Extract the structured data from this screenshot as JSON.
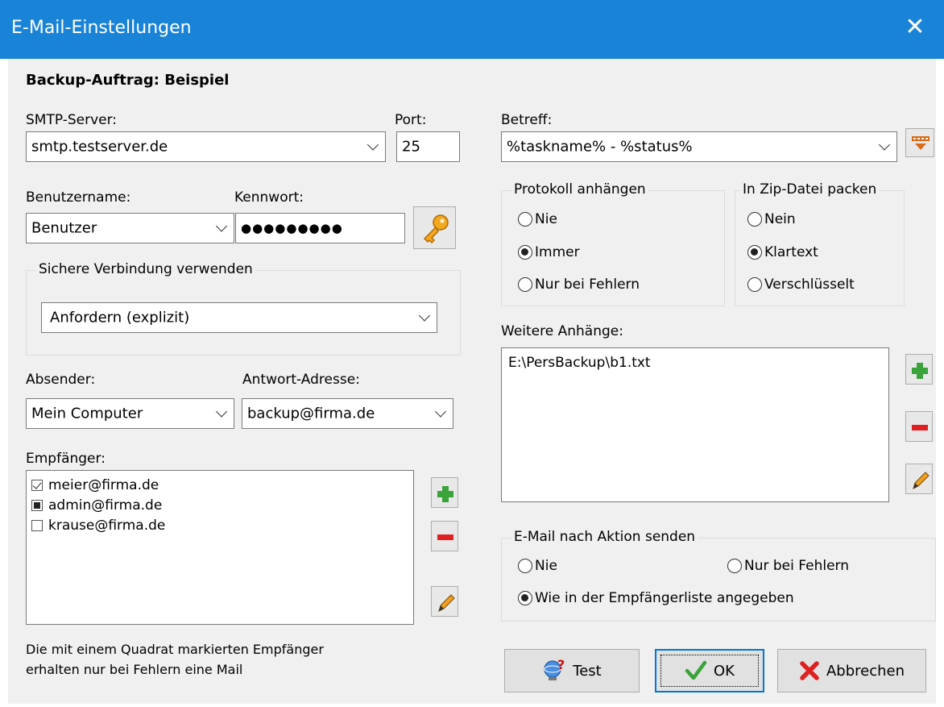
{
  "window": {
    "title": "E-Mail-Einstellungen",
    "close_glyph": "✕"
  },
  "task_label": "Backup-Auftrag: Beispiel",
  "smtp": {
    "label": "SMTP-Server:",
    "value": "smtp.testserver.de"
  },
  "port": {
    "label": "Port:",
    "value": "25"
  },
  "username": {
    "label": "Benutzername:",
    "value": "Benutzer"
  },
  "password": {
    "label": "Kennwort:",
    "value": "●●●●●●●●●"
  },
  "secure": {
    "group_title": "Sichere Verbindung verwenden",
    "value": "Anfordern (explizit)"
  },
  "sender": {
    "label": "Absender:",
    "value": "Mein Computer"
  },
  "reply": {
    "label": "Antwort-Adresse:",
    "value": "backup@firma.de"
  },
  "recipients": {
    "label": "Empfänger:",
    "items": [
      {
        "address": "meier@firma.de",
        "state": "checked"
      },
      {
        "address": "admin@firma.de",
        "state": "square"
      },
      {
        "address": "krause@firma.de",
        "state": "unchecked"
      }
    ]
  },
  "note": {
    "line1": "Die mit einem Quadrat markierten Empfänger",
    "line2": "erhalten nur bei Fehlern eine Mail"
  },
  "subject": {
    "label": "Betreff:",
    "value": "%taskname% - %status%"
  },
  "attach_log": {
    "group_title": "Protokoll anhängen",
    "options": [
      "Nie",
      "Immer",
      "Nur bei Fehlern"
    ],
    "selected": "Immer"
  },
  "zip": {
    "group_title": "In Zip-Datei packen",
    "options": [
      "Nein",
      "Klartext",
      "Verschlüsselt"
    ],
    "selected": "Klartext"
  },
  "attachments": {
    "label": "Weitere Anhänge:",
    "items": [
      "E:\\PersBackup\\b1.txt"
    ]
  },
  "send_mail": {
    "group_title": "E-Mail nach Aktion senden",
    "options": [
      "Nie",
      "Nur bei Fehlern",
      "Wie in der Empfängerliste angegeben"
    ],
    "selected": "Wie in der Empfängerliste angegeben"
  },
  "buttons": {
    "test": "Test",
    "ok": "OK",
    "cancel": "Abbrechen"
  },
  "colors": {
    "titlebar": "#1883d7",
    "plus": "#3aa33a",
    "minus": "#e02020",
    "key": "#e89a16",
    "dialog_bg": "#f0f0f0"
  }
}
